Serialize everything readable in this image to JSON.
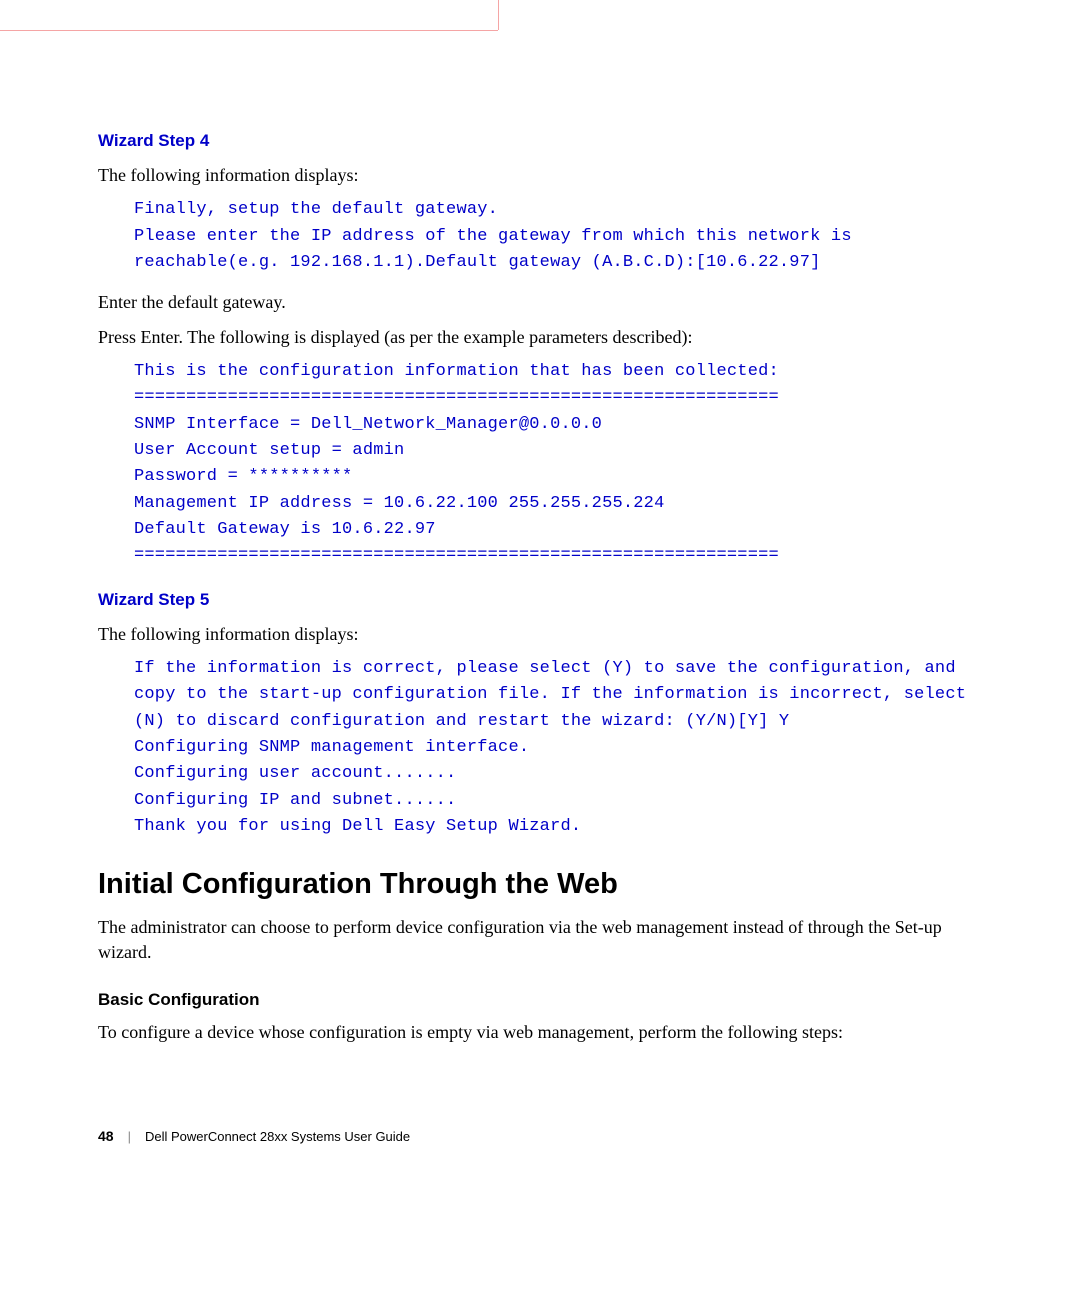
{
  "headers": {
    "wizard_step_4": "Wizard Step 4",
    "wizard_step_5": "Wizard Step 5",
    "initial_config": "Initial Configuration Through the Web",
    "basic_config": "Basic Configuration"
  },
  "body": {
    "info_displays": "The following information displays:",
    "enter_gateway": "Enter the default gateway.",
    "press_enter": "Press Enter. The following is displayed (as per the example parameters described):",
    "admin_choose": "The administrator can choose to perform device configuration via the web management instead of through the Set-up wizard.",
    "configure_device": "To configure a device whose configuration is empty via web management, perform the following steps:"
  },
  "code": {
    "step4_block1": "Finally, setup the default gateway.\nPlease enter the IP address of the gateway from which this network is reachable(e.g. 192.168.1.1).Default gateway (A.B.C.D):[10.6.22.97]",
    "step4_block2": "This is the configuration information that has been collected:\n==============================================================\nSNMP Interface = Dell_Network_Manager@0.0.0.0\nUser Account setup = admin\nPassword = **********\nManagement IP address = 10.6.22.100 255.255.255.224\nDefault Gateway is 10.6.22.97\n==============================================================",
    "step5_block1": "If the information is correct, please select (Y) to save the configuration, and copy to the start-up configuration file. If the information is incorrect, select (N) to discard configuration and restart the wizard: (Y/N)[Y] Y\nConfiguring SNMP management interface.\nConfiguring user account.......\nConfiguring IP and subnet......\nThank you for using Dell Easy Setup Wizard."
  },
  "footer": {
    "page": "48",
    "title": "Dell PowerConnect 28xx Systems User Guide"
  }
}
